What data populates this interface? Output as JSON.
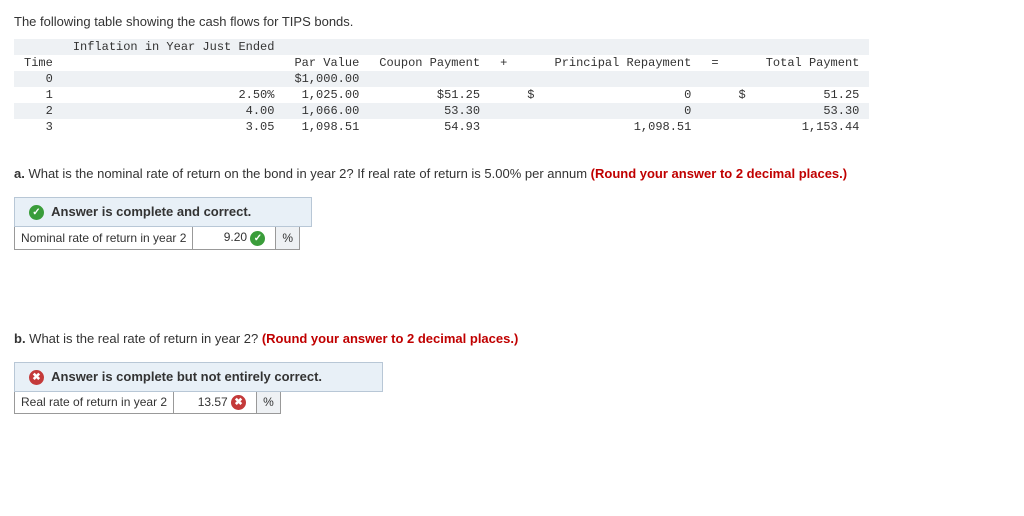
{
  "intro": "The following table showing the cash flows for TIPS bonds.",
  "headers": {
    "time": "Time",
    "inflation": "Inflation in Year Just Ended",
    "par": "Par Value",
    "coupon": "Coupon Payment",
    "plus": "+",
    "principal": "Principal Repayment",
    "equals": "=",
    "total": "Total Payment"
  },
  "rows": [
    {
      "time": "0",
      "infl": "",
      "par": "$1,000.00",
      "coupon": "",
      "dollar": "",
      "principal": "",
      "tdollar": "",
      "total": ""
    },
    {
      "time": "1",
      "infl": "2.50%",
      "par": "1,025.00",
      "coupon": "$51.25",
      "dollar": "$",
      "principal": "0",
      "tdollar": "$",
      "total": "51.25"
    },
    {
      "time": "2",
      "infl": "4.00",
      "par": "1,066.00",
      "coupon": "53.30",
      "dollar": "",
      "principal": "0",
      "tdollar": "",
      "total": "53.30"
    },
    {
      "time": "3",
      "infl": "3.05",
      "par": "1,098.51",
      "coupon": "54.93",
      "dollar": "",
      "principal": "1,098.51",
      "tdollar": "",
      "total": "1,153.44"
    }
  ],
  "qa": {
    "prefix": "a.",
    "text": " What is the nominal rate of return on the bond in year 2? If real rate of return is 5.00% per annum ",
    "round": "(Round your answer to 2 decimal places.)",
    "feedback": "Answer is complete and correct.",
    "label": "Nominal rate of return in year 2",
    "value": "9.20",
    "unit": "%"
  },
  "qb": {
    "prefix": "b.",
    "text": " What is the real rate of return in year 2? ",
    "round": "(Round your answer to 2 decimal places.)",
    "feedback": "Answer is complete but not entirely correct.",
    "label": "Real rate of return in year 2",
    "value": "13.57",
    "unit": "%"
  },
  "chart_data": {
    "type": "table",
    "columns": [
      "Time",
      "Inflation in Year Just Ended",
      "Par Value",
      "Coupon Payment",
      "Principal Repayment",
      "Total Payment"
    ],
    "rows": [
      [
        0,
        null,
        1000.0,
        null,
        null,
        null
      ],
      [
        1,
        2.5,
        1025.0,
        51.25,
        0,
        51.25
      ],
      [
        2,
        4.0,
        1066.0,
        53.3,
        0,
        53.3
      ],
      [
        3,
        3.05,
        1098.51,
        54.93,
        1098.51,
        1153.44
      ]
    ]
  }
}
